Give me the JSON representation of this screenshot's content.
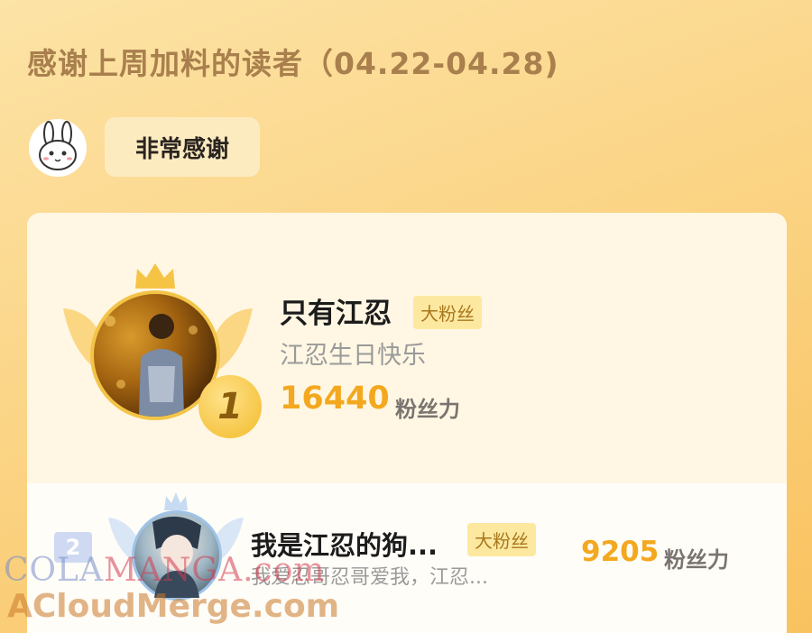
{
  "header": {
    "title": "感谢上周加料的读者（04.22-04.28)"
  },
  "greeting": {
    "bubble_text": "非常感谢"
  },
  "ranking": [
    {
      "rank": "1",
      "name": "只有江忍",
      "badge": "大粉丝",
      "message": "江忍生日快乐",
      "score": "16440",
      "unit": "粉丝力"
    },
    {
      "rank": "2",
      "name": "我是江忍的狗...",
      "badge": "大粉丝",
      "message": "我爱忍哥忍哥爱我，江忍...",
      "score": "9205",
      "unit": "粉丝力"
    }
  ],
  "watermark": {
    "line1_part1": "COLA",
    "line1_part2": "MANGA",
    "line1_part3": ".com",
    "line2": "ACloudMerge.com"
  },
  "colors": {
    "accent": "#f3a81f",
    "badge_bg": "#fde8a0",
    "title": "#a87f4d"
  }
}
